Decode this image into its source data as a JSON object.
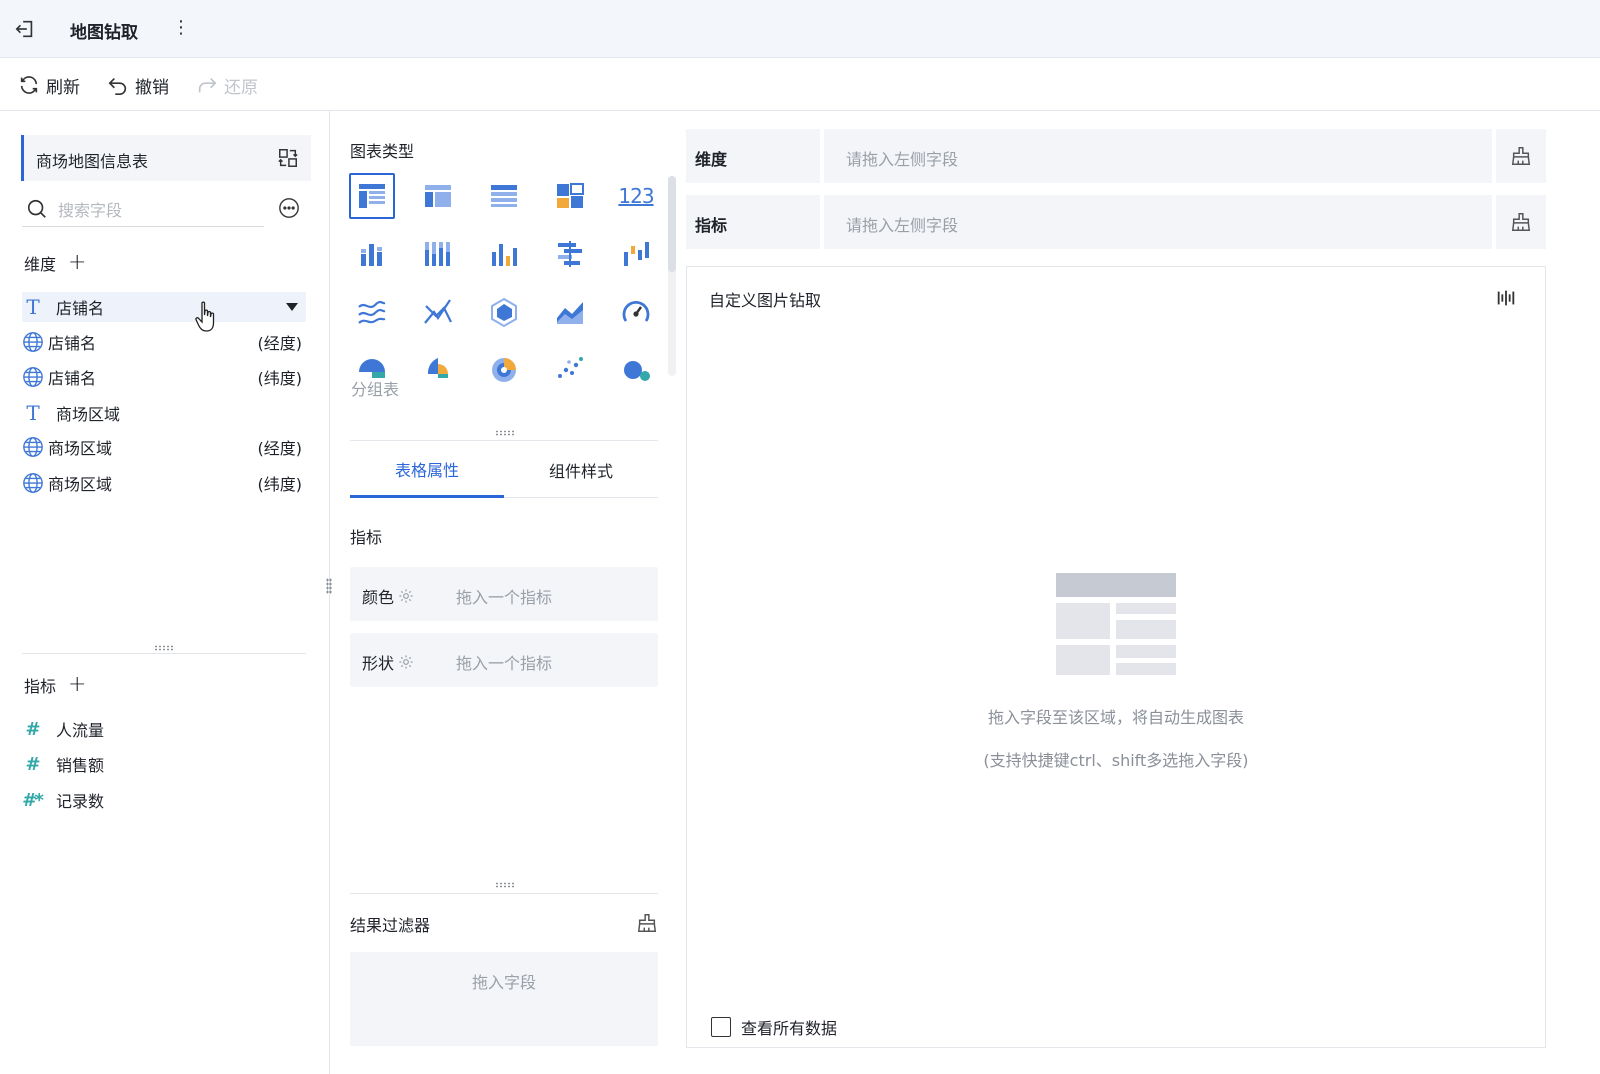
{
  "app": {
    "title": "地图钻取"
  },
  "toolbar": {
    "refresh_label": "刷新",
    "undo_label": "撤销",
    "redo_label": "还原"
  },
  "datasource": {
    "name": "商场地图信息表",
    "search_placeholder": "搜索字段"
  },
  "dimensions": {
    "title": "维度",
    "fields": [
      {
        "label": "店铺名",
        "type": "text",
        "suffix": ""
      },
      {
        "label": "店铺名",
        "type": "geo",
        "suffix": "(经度)"
      },
      {
        "label": "店铺名",
        "type": "geo",
        "suffix": "(纬度)"
      },
      {
        "label": "商场区域",
        "type": "text",
        "suffix": ""
      },
      {
        "label": "商场区域",
        "type": "geo",
        "suffix": "(经度)"
      },
      {
        "label": "商场区域",
        "type": "geo",
        "suffix": "(纬度)"
      }
    ]
  },
  "measures": {
    "title": "指标",
    "fields": [
      {
        "label": "人流量",
        "icon": "#"
      },
      {
        "label": "销售额",
        "icon": "#"
      },
      {
        "label": "记录数",
        "icon": "#*"
      }
    ]
  },
  "chart_types": {
    "title": "图表类型",
    "selected_tooltip": "分组表",
    "number_icon": "123"
  },
  "props": {
    "tab_table": "表格属性",
    "tab_style": "组件样式",
    "section": "指标",
    "color_label": "颜色",
    "color_placeholder": "拖入一个指标",
    "shape_label": "形状",
    "shape_placeholder": "拖入一个指标",
    "filter_title": "结果过滤器",
    "filter_placeholder": "拖入字段"
  },
  "shelves": {
    "dimension_label": "维度",
    "dimension_placeholder": "请拖入左侧字段",
    "measure_label": "指标",
    "measure_placeholder": "请拖入左侧字段"
  },
  "canvas": {
    "title": "自定义图片钻取",
    "hint": "拖入字段至该区域，将自动生成图表",
    "hint_sub": "(支持快捷键ctrl、shift多选拖入字段)",
    "view_all": "查看所有数据"
  },
  "colors": {
    "accent": "#2b66d8",
    "chart_blue": "#3f77d6",
    "chart_orange": "#f2a93b",
    "measure_teal": "#32a8a8"
  }
}
